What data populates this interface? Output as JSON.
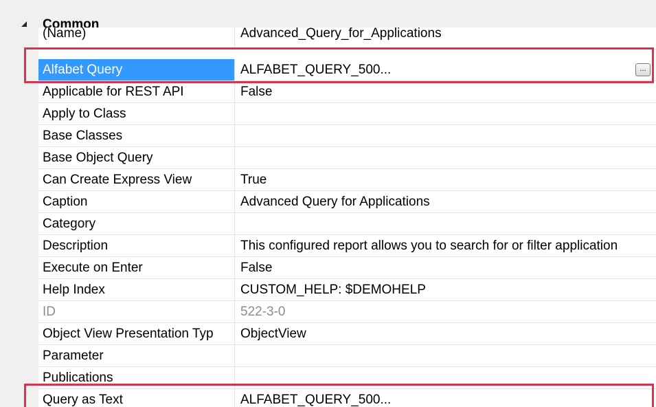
{
  "category": {
    "label": "Common",
    "expanded_icon": "expanded-triangle-icon"
  },
  "rows": [
    {
      "name": "(Name)",
      "value": "Advanced_Query_for_Applications"
    },
    {
      "name": "Alfabet Query",
      "value": "ALFABET_QUERY_500...",
      "selected": true,
      "has_ellipsis_button": true,
      "ellipsis_label": "..."
    },
    {
      "name": "Applicable for REST API",
      "value": "False"
    },
    {
      "name": "Apply to Class",
      "value": ""
    },
    {
      "name": "Base Classes",
      "value": ""
    },
    {
      "name": "Base Object Query",
      "value": ""
    },
    {
      "name": "Can Create Express View",
      "value": "True"
    },
    {
      "name": "Caption",
      "value": "Advanced Query for Applications"
    },
    {
      "name": "Category",
      "value": ""
    },
    {
      "name": "Description",
      "value": "This configured report allows you to search for or filter application"
    },
    {
      "name": "Execute on Enter",
      "value": "False"
    },
    {
      "name": "Help Index",
      "value": "CUSTOM_HELP: $DEMOHELP"
    },
    {
      "name": "ID",
      "value": "522-3-0",
      "disabled": true
    },
    {
      "name": "Object View Presentation Typ",
      "value": "ObjectView"
    },
    {
      "name": "Parameter",
      "value": ""
    },
    {
      "name": "Publications",
      "value": ""
    },
    {
      "name": "Query as Text",
      "value": "ALFABET_QUERY_500..."
    }
  ],
  "colors": {
    "selection": "#3399ff",
    "highlight_box": "#d9334f",
    "category_background": "#f0f0f0",
    "grid_line": "#e3e3e3"
  }
}
